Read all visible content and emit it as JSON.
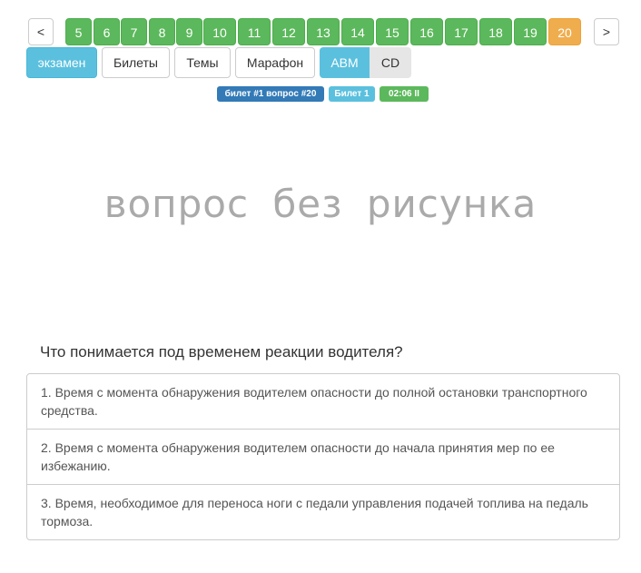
{
  "pager": {
    "prev": "<",
    "next": ">",
    "pages": [
      "5",
      "6",
      "7",
      "8",
      "9",
      "10",
      "11",
      "12",
      "13",
      "14",
      "15",
      "16",
      "17",
      "18",
      "19",
      "20"
    ],
    "current": "20"
  },
  "modes": [
    "экзамен",
    "Билеты",
    "Темы",
    "Марафон"
  ],
  "categories": [
    "ABM",
    "CD"
  ],
  "badges": {
    "ticket_question": "билет #1 вопрос #20",
    "ticket": "Билет 1",
    "timer": "02:06 II"
  },
  "image_placeholder": "вопрос без рисунка",
  "question": "Что понимается под временем реакции водителя?",
  "answers": [
    "1. Время с момента обнаружения водителем опасности до полной остановки транспортного средства.",
    "2. Время с момента обнаружения водителем опасности до начала принятия мер по ее избежанию.",
    "3. Время, необходимое для переноса ноги с педали управления подачей топлива на педаль тормоза."
  ],
  "colors": {
    "answered": "#5cb85c",
    "current": "#f0ad4e",
    "active_mode": "#5bc0de",
    "badge_primary": "#337ab7"
  }
}
